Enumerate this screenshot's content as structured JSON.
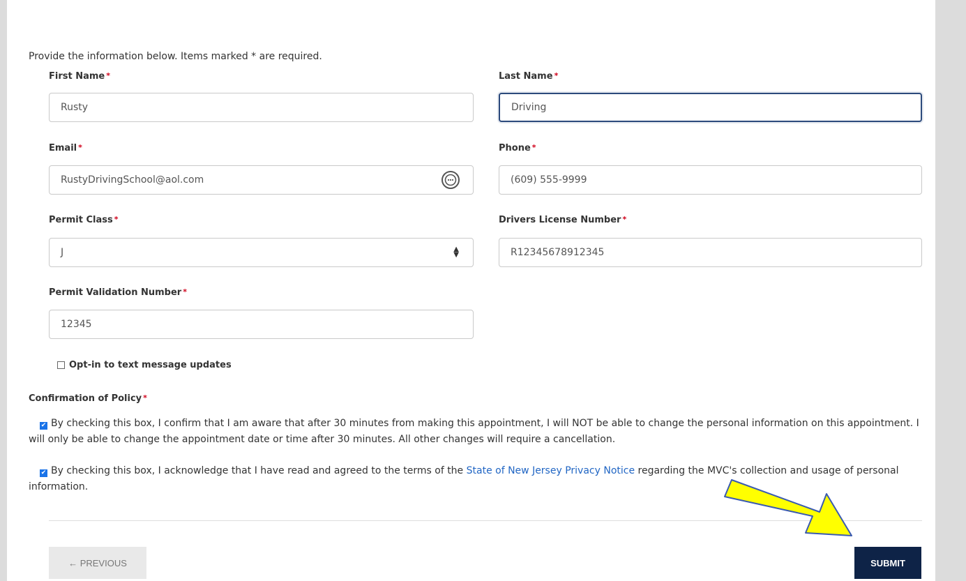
{
  "intro": "Provide the information below. Items marked * are required.",
  "required_mark": "*",
  "fields": {
    "first_name": {
      "label": "First Name",
      "value": "Rusty"
    },
    "last_name": {
      "label": "Last Name",
      "value": "Driving"
    },
    "email": {
      "label": "Email",
      "value": "RustyDrivingSchool@aol.com"
    },
    "phone": {
      "label": "Phone",
      "value": "(609) 555-9999"
    },
    "permit_class": {
      "label": "Permit Class",
      "value": "J"
    },
    "license_number": {
      "label": "Drivers License Number",
      "value": "R12345678912345"
    },
    "permit_validation": {
      "label": "Permit Validation Number",
      "value": "12345"
    }
  },
  "opt_in": {
    "label": "Opt-in to text message updates",
    "checked": false
  },
  "policy": {
    "label": "Confirmation of Policy",
    "item1": "By checking this box, I confirm that I am aware that after 30 minutes from making this appointment, I will NOT be able to change the personal information on this appointment. I will only be able to change the appointment date or time after 30 minutes. All other changes will require a cancellation.",
    "item2_before": "By checking this box, I acknowledge that I have read and agreed to the terms of the ",
    "item2_link": "State of New Jersey Privacy Notice",
    "item2_after": " regarding the MVC's collection and usage of personal information."
  },
  "buttons": {
    "previous": "← PREVIOUS",
    "submit": "SUBMIT"
  },
  "colors": {
    "submit_bg": "#0e2347",
    "link": "#2166c4",
    "required": "#d0021b",
    "arrow_fill": "#ffff00"
  }
}
